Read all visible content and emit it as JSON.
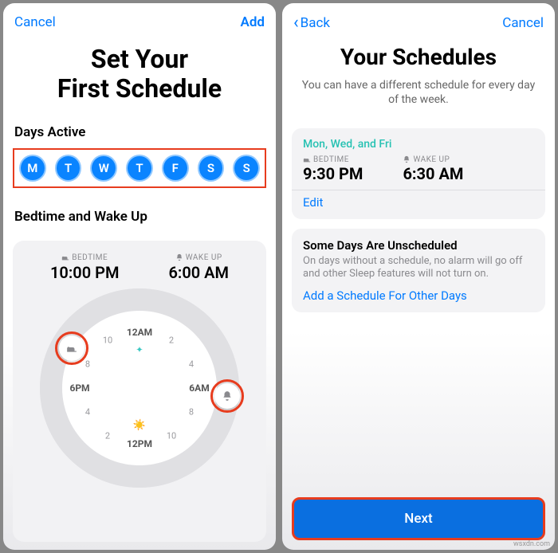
{
  "left": {
    "nav": {
      "cancel": "Cancel",
      "add": "Add"
    },
    "title_line1": "Set Your",
    "title_line2": "First Schedule",
    "days_label": "Days Active",
    "days": [
      "M",
      "T",
      "W",
      "T",
      "F",
      "S",
      "S"
    ],
    "bedtime_section": "Bedtime and Wake Up",
    "bedtime_label": "BEDTIME",
    "bedtime_value": "10:00 PM",
    "wake_label": "WAKE UP",
    "wake_value": "6:00 AM",
    "clock_ticks": {
      "12am": "12AM",
      "2": "2",
      "4": "4",
      "6am": "6AM",
      "8": "8",
      "10": "10",
      "12pm": "12PM",
      "2p": "2",
      "4p": "4",
      "6pm": "6PM",
      "8p": "8",
      "10p": "10"
    }
  },
  "right": {
    "nav": {
      "back": "Back",
      "cancel": "Cancel"
    },
    "title": "Your Schedules",
    "subtext": "You can have a different schedule for every day of the week.",
    "schedule": {
      "days": "Mon, Wed, and Fri",
      "bed_label": "BEDTIME",
      "bed": "9:30 PM",
      "wake_label": "WAKE UP",
      "wake": "6:30 AM",
      "edit": "Edit"
    },
    "unscheduled": {
      "title": "Some Days Are Unscheduled",
      "body": "On days without a schedule, no alarm will go off and other Sleep features will not turn on.",
      "link": "Add a Schedule For Other Days"
    },
    "next": "Next"
  },
  "watermark": "wsxdn.com"
}
